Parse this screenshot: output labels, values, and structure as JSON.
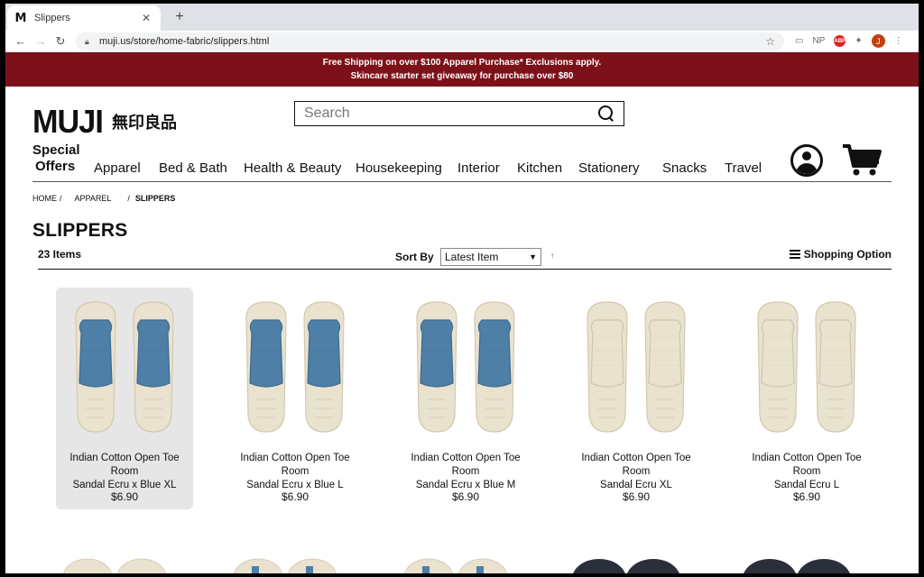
{
  "browser": {
    "tab_title": "Slippers",
    "tab_favicon": "M",
    "url": "muji.us/store/home-fabric/slippers.html",
    "ext_np": "NP",
    "ext_abp": "ABP",
    "profile_initial": "J"
  },
  "promo": {
    "line1": "Free Shipping on over $100 Apparel Purchase* Exclusions apply.",
    "line2": "Skincare starter set giveaway for purchase over $80",
    "bg_color": "#7d1119"
  },
  "header": {
    "logo_text": "MUJI",
    "logo_jp": "無印良品",
    "search_placeholder": "Search"
  },
  "nav": {
    "special_line1": "Special",
    "special_line2": "Offers",
    "items": [
      "Apparel",
      "Bed & Bath",
      "Health & Beauty",
      "Housekeeping",
      "Interior",
      "Kitchen",
      "Stationery",
      "Snacks",
      "Travel"
    ]
  },
  "breadcrumb": {
    "home": "HOME",
    "apparel": "APPAREL",
    "sep": "/",
    "current": "SLIPPERS"
  },
  "page": {
    "title": "SLIPPERS",
    "items_count": "23 Items",
    "sort_label": "Sort By",
    "sort_value": "Latest Item",
    "sort_dir": "↑",
    "shopping_option": "Shopping Option"
  },
  "products": [
    {
      "name_l1": "Indian Cotton Open Toe Room",
      "name_l2": "Sandal Ecru x Blue XL",
      "price": "$6.90",
      "color": "blue"
    },
    {
      "name_l1": "Indian Cotton Open Toe Room",
      "name_l2": "Sandal Ecru x Blue L",
      "price": "$6.90",
      "color": "blue"
    },
    {
      "name_l1": "Indian Cotton Open Toe Room",
      "name_l2": "Sandal Ecru x Blue M",
      "price": "$6.90",
      "color": "blue"
    },
    {
      "name_l1": "Indian Cotton Open Toe Room",
      "name_l2": "Sandal Ecru XL",
      "price": "$6.90",
      "color": "ecru"
    },
    {
      "name_l1": "Indian Cotton Open Toe Room",
      "name_l2": "Sandal Ecru L",
      "price": "$6.90",
      "color": "ecru"
    }
  ],
  "colors": {
    "ecru": "#e9e2cf",
    "blue": "#4e7fa6",
    "navy": "#2a2f3a"
  }
}
